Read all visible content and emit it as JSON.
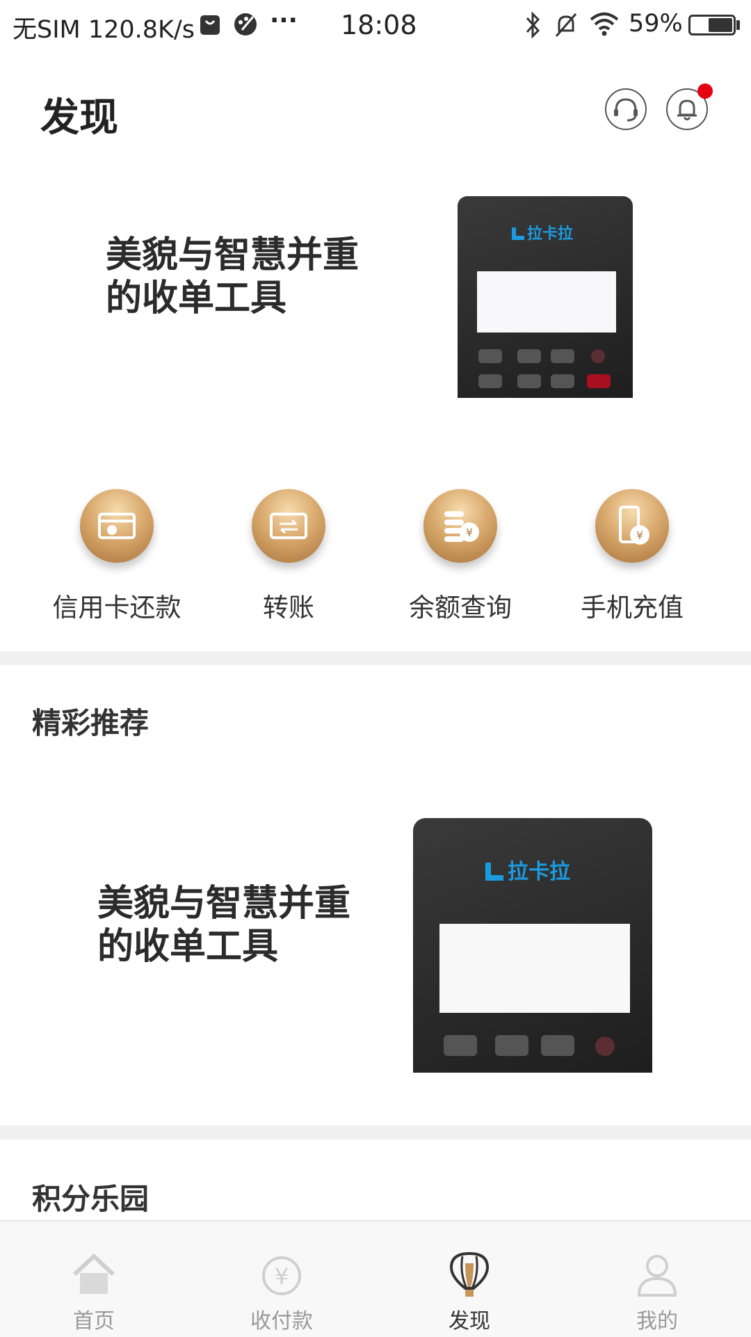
{
  "status_bar": {
    "left_text": "无SIM 120.8K/s",
    "more": "···",
    "time": "18:08",
    "battery": "59%",
    "battery_level": 0.59
  },
  "header": {
    "title": "发现",
    "service_icon": "headset-icon",
    "notification_icon": "bell-icon",
    "notification_dot": true
  },
  "banner_top": {
    "line1": "美貌与智慧并重",
    "line2": "的收单工具",
    "device_brand": "拉卡拉"
  },
  "quick_actions": [
    {
      "label": "信用卡还款",
      "icon": "credit-card-repay-icon"
    },
    {
      "label": "转账",
      "icon": "transfer-icon"
    },
    {
      "label": "余额查询",
      "icon": "balance-query-icon"
    },
    {
      "label": "手机充值",
      "icon": "phone-recharge-icon"
    }
  ],
  "recommend": {
    "title": "精彩推荐",
    "card_line1": "美貌与智慧并重",
    "card_line2": "的收单工具",
    "device_brand": "拉卡拉"
  },
  "points": {
    "title": "积分乐园"
  },
  "bottom_nav": {
    "items": [
      {
        "label": "首页",
        "icon": "home-icon",
        "active": false
      },
      {
        "label": "收付款",
        "icon": "yen-circle-icon",
        "active": false
      },
      {
        "label": "发现",
        "icon": "balloon-icon",
        "active": true
      },
      {
        "label": "我的",
        "icon": "user-icon",
        "active": false
      }
    ]
  },
  "colors": {
    "accent_gold": "#c7955a",
    "brand_blue": "#1a9be0",
    "notification_red": "#e60012",
    "divider": "#f0f0f0"
  }
}
